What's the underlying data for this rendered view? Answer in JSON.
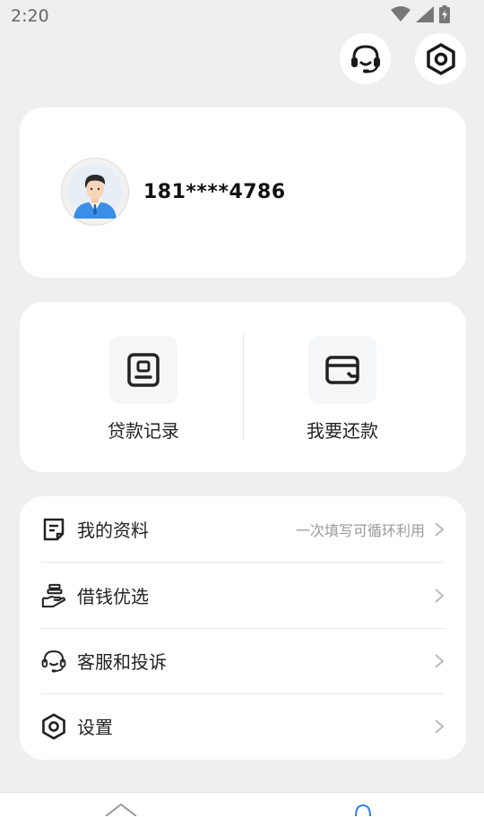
{
  "status_bar": {
    "time": "2:20"
  },
  "profile": {
    "phone": "181****4786"
  },
  "actions": [
    {
      "label": "贷款记录",
      "icon": "record-icon"
    },
    {
      "label": "我要还款",
      "icon": "wallet-icon"
    }
  ],
  "menu": [
    {
      "label": "我的资料",
      "hint": "一次填写可循环利用",
      "icon": "document-icon"
    },
    {
      "label": "借钱优选",
      "icon": "hand-money-icon"
    },
    {
      "label": "客服和投诉",
      "icon": "headset-icon"
    },
    {
      "label": "设置",
      "icon": "settings-icon"
    }
  ]
}
